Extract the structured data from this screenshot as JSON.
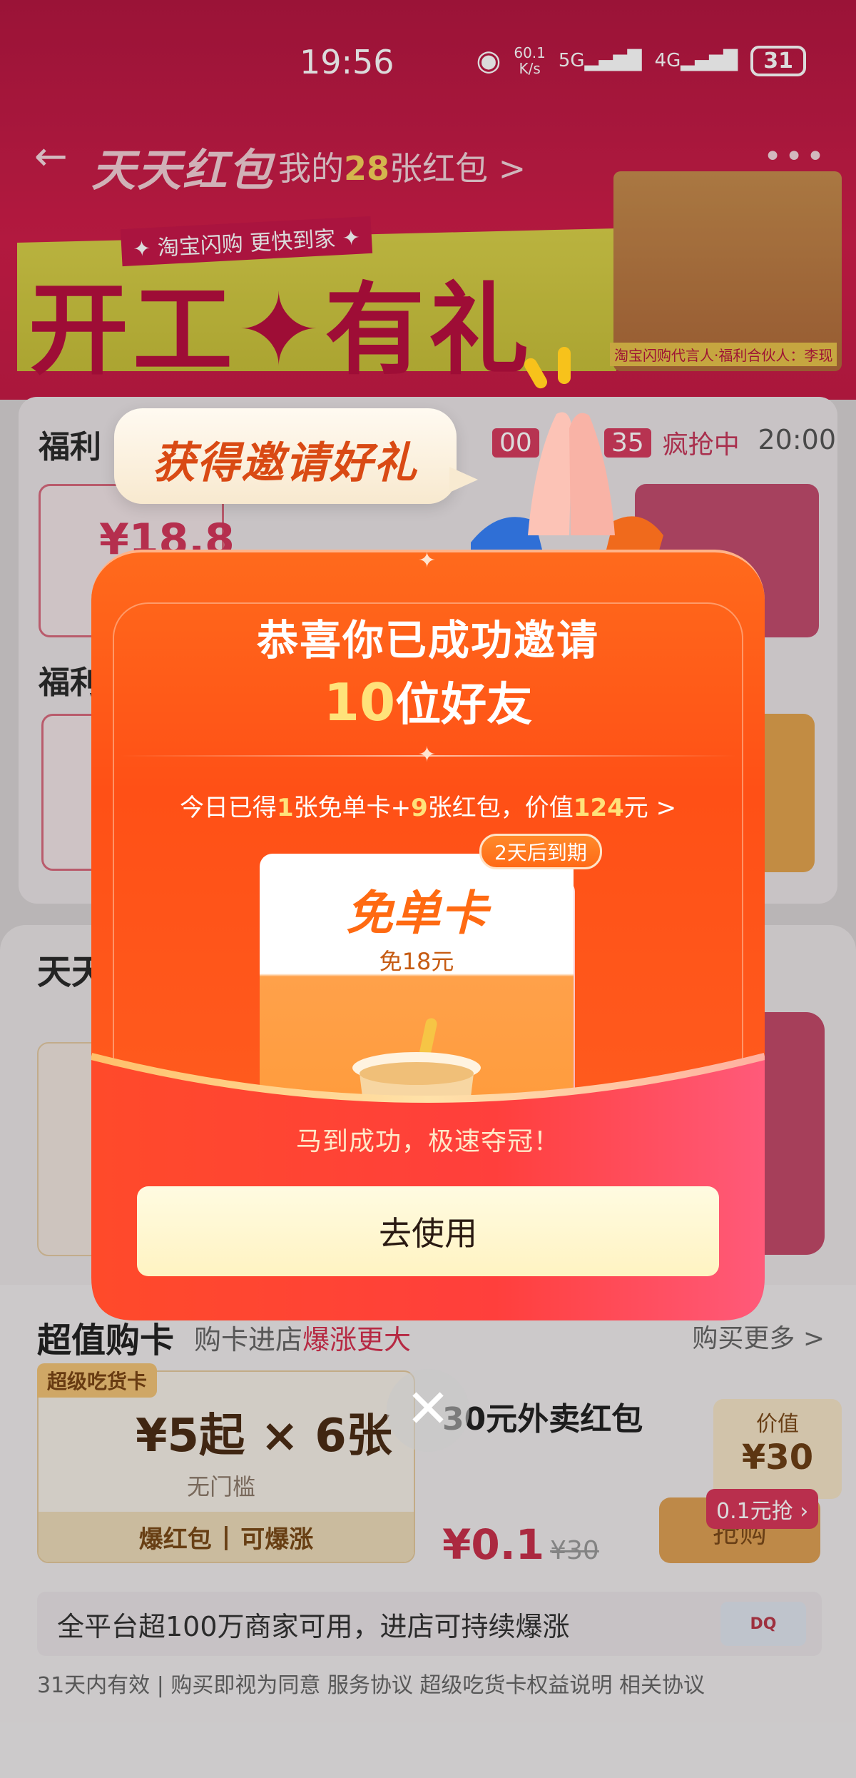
{
  "status_bar": {
    "time": "19:56",
    "network_speed": "60.1\nK/s",
    "signal1": "5G",
    "signal2": "4G",
    "battery": "31"
  },
  "header": {
    "title": "天天红包",
    "my_label_prefix": "我的",
    "my_count": "28",
    "my_label_suffix": "张红包 >"
  },
  "banner": {
    "subtitle": "✦ 淘宝闪购 更快到家 ✦",
    "main": "开工✦有礼",
    "caption": "淘宝闪购代言人·福利合伙人：李现"
  },
  "welfare": {
    "title1": "福利",
    "title2": "福利",
    "timer": [
      "00",
      ":",
      "..",
      ":",
      "35"
    ],
    "timer_text": "疯抢中",
    "time_right": "20:00",
    "coupon_amount": "¥18.8"
  },
  "daily": {
    "title": "天天"
  },
  "buy_card": {
    "title": "超值购卡",
    "subtitle_prefix": "购卡进店",
    "subtitle_highlight": "爆涨更大",
    "more": "购买更多 >",
    "badge": "超级吃货卡",
    "price": "¥5起 × 6张",
    "threshold": "无门槛",
    "bottom_left": "爆红包",
    "bottom_right": "可爆涨",
    "right_title": "30元外卖红包",
    "right_price": "¥0.1",
    "right_old_price": "¥30",
    "buy_label": "抢购",
    "mini_l1": "价值",
    "mini_l2": "¥30",
    "tag": "0.1元抢 ›"
  },
  "merchant": {
    "text": "全平台超100万商家可用，进店可持续爆涨",
    "logo": "DQ"
  },
  "footer": {
    "text": "31天内有效 | 购买即视为同意 服务协议 超级吃货卡权益说明 相关协议"
  },
  "modal": {
    "bubble": "获得邀请好礼",
    "heading1": "恭喜你已成功邀请",
    "heading2_num": "10",
    "heading2_suffix": "位好友",
    "summary_pre": "今日已得",
    "summary_n1": "1",
    "summary_mid1": "张免单卡+",
    "summary_n2": "9",
    "summary_mid2": "张红包，价值",
    "summary_n3": "124",
    "summary_suf": "元 >",
    "card_title": "免单卡",
    "card_sub": "免18元",
    "expire": "2天后到期",
    "slogan": "马到成功，极速夺冠！",
    "use_button": "去使用"
  },
  "colors": {
    "modal_orange": "#ff5016",
    "highlight_yellow": "#ffe27a",
    "button_cream": "#fff3c2"
  }
}
